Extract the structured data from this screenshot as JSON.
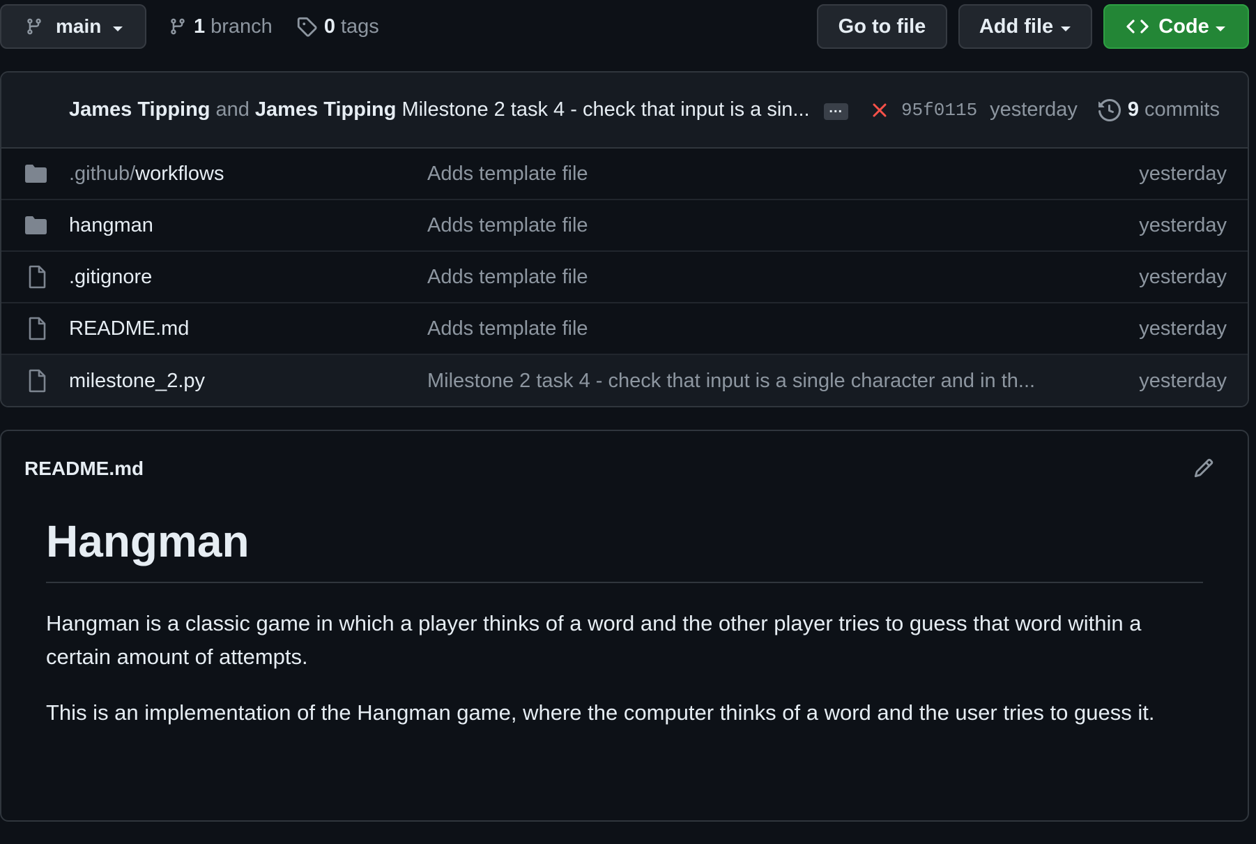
{
  "topbar": {
    "branch": "main",
    "branch_count": "1",
    "branch_label": "branch",
    "tag_count": "0",
    "tag_label": "tags",
    "goto_label": "Go to file",
    "addfile_label": "Add file",
    "code_label": "Code"
  },
  "commit": {
    "author1": "James Tipping",
    "and": "and",
    "author2": "James Tipping",
    "message": "Milestone 2 task 4 - check that input is a sin...",
    "ellipsis": "...",
    "sha": "95f0115",
    "time": "yesterday",
    "count": "9",
    "count_label": "commits"
  },
  "files": [
    {
      "prefix": ".github/",
      "name": "workflows",
      "type": "folder",
      "message": "Adds template file",
      "date": "yesterday"
    },
    {
      "prefix": "",
      "name": "hangman",
      "type": "folder",
      "message": "Adds template file",
      "date": "yesterday"
    },
    {
      "prefix": "",
      "name": ".gitignore",
      "type": "file",
      "message": "Adds template file",
      "date": "yesterday"
    },
    {
      "prefix": "",
      "name": "README.md",
      "type": "file",
      "message": "Adds template file",
      "date": "yesterday"
    },
    {
      "prefix": "",
      "name": "milestone_2.py",
      "type": "file",
      "message": "Milestone 2 task 4 - check that input is a single character and in th...",
      "date": "yesterday"
    }
  ],
  "readme": {
    "filename": "README.md",
    "heading": "Hangman",
    "p1": "Hangman is a classic game in which a player thinks of a word and the other player tries to guess that word within a certain amount of attempts.",
    "p2": "This is an implementation of the Hangman game, where the computer thinks of a word and the user tries to guess it."
  },
  "colors": {
    "background": "#0d1117",
    "code_button": "#238636",
    "fail": "#f85149"
  }
}
